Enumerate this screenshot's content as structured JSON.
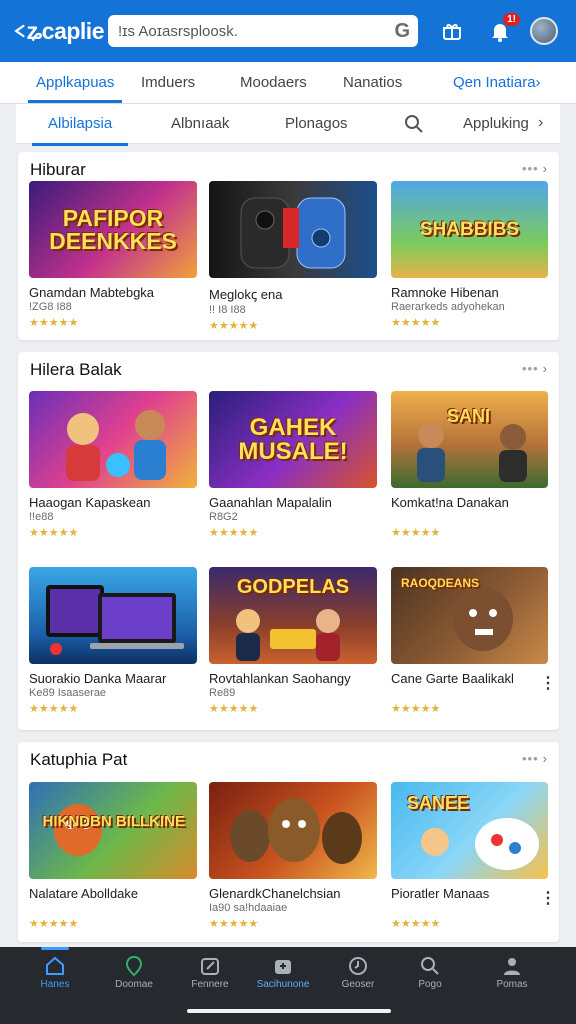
{
  "app": {
    "logo_text": "ʑcaplie",
    "search_placeholder": "!ɪs Aoɪasrsploosk.",
    "search_glyph": "G",
    "notification_count": "1!"
  },
  "primary_tabs": [
    {
      "label": "Applkapuas",
      "active": true
    },
    {
      "label": "Imduers"
    },
    {
      "label": "Moodaers"
    },
    {
      "label": "Nanatios"
    },
    {
      "label": "Qen Inatiara›"
    }
  ],
  "secondary_tabs": [
    {
      "label": "Albilapsia",
      "active": true
    },
    {
      "label": "Albnıaak"
    },
    {
      "label": "Plonagos"
    },
    {
      "label": "Appluking"
    }
  ],
  "sections": [
    {
      "title": "Hiburar",
      "more": "•••",
      "cards": [
        {
          "title": "Gnamdan Mabtebgka",
          "sub": "!ZG8 I88",
          "stars": "★★★★★",
          "art": "PAFIPOR DEENKKES",
          "bg": "linear-gradient(135deg,#3a1c7a,#c2318d 55%,#f0a23b)",
          "text_color": "#ffd54a"
        },
        {
          "title": "Meglokꞔ ena",
          "sub": "!! I8 I88",
          "stars": "★★★★★",
          "art": "",
          "bg": "linear-gradient(90deg,#141414,#3a3a3a 50%,#1d4f8c)",
          "text_color": "#fff"
        },
        {
          "title": "Ramnoke Hibenan",
          "sub": "Raerarkeds adyohekan",
          "stars": "★★★★★",
          "art": "SHABBIBS",
          "bg": "linear-gradient(180deg,#4fa6e6,#7dcb5b 65%,#e8b24a)",
          "text_color": "#ffd54a"
        }
      ]
    },
    {
      "title": "Hilera Balak",
      "more": "•••",
      "cards": [
        {
          "title": "Haaogan Kapaskean",
          "sub": "!!e88",
          "stars": "★★★★★",
          "art": "",
          "bg": "linear-gradient(135deg,#6a2fb8,#e0418f 50%,#f2b13a)",
          "text_color": "#fff"
        },
        {
          "title": "Gaanahlan Mapalalin",
          "sub": "R8G2",
          "stars": "★★★★★",
          "art": "GAHEK MUSALE!",
          "bg": "linear-gradient(135deg,#2a1f7a,#8a2fc4 55%,#d8542a)",
          "text_color": "#ffd54a"
        },
        {
          "title": "Komkat!na Danakan",
          "sub": "",
          "stars": "★★★★★",
          "art": "SANI",
          "bg": "linear-gradient(180deg,#f0b04a,#b4733a 55%,#3c6b2f)",
          "text_color": "#ffe07a"
        },
        {
          "title": "Suorakio Danka Maarar",
          "sub": "Ke89 Isaaserae",
          "stars": "★★★★★",
          "art": "",
          "bg": "linear-gradient(180deg,#39a6e8,#1b5fa8 70%,#0d2f63)",
          "text_color": "#fff"
        },
        {
          "title": "Rovtahlankan Saohangy",
          "sub": "Re89",
          "stars": "★★★★★",
          "art": "GODPELAS",
          "bg": "linear-gradient(180deg,#3a2a6e,#8a3f2a 60%,#c9622f)",
          "text_color": "#ffd54a"
        },
        {
          "title": "Cane Garte Baalikakl",
          "sub": "",
          "stars": "★★★★★",
          "art": "RAOQDEANS",
          "bg": "linear-gradient(135deg,#4a3322,#8b5a33 55%,#c98a4a)",
          "text_color": "#ffcf5a"
        }
      ]
    },
    {
      "title": "Katuphia Pat",
      "more": "•••",
      "cards": [
        {
          "title": "Nalatare Abolldake",
          "sub": "",
          "stars": "★★★★★",
          "art": "HIKNDBN BILLKINE",
          "bg": "linear-gradient(135deg,#2f6fb8,#6cb84a 55%,#d88a2a)",
          "text_color": "#ffd54a"
        },
        {
          "title": "GlenardkChanelchsian",
          "sub": "Ia90 sa!hdaaiae",
          "stars": "★★★★★",
          "art": "",
          "bg": "linear-gradient(135deg,#7a2010,#c9531f 55%,#f0b84a)",
          "text_color": "#fff"
        },
        {
          "title": "Pioratler Manaas",
          "sub": "",
          "stars": "★★★★★",
          "art": "SANEE",
          "bg": "linear-gradient(135deg,#47b9f0,#8ad6f6 55%,#f7c04a)",
          "text_color": "#ffd54a"
        }
      ]
    }
  ],
  "bottom_nav": [
    {
      "label": "Hanes",
      "icon": "home-icon",
      "active": true
    },
    {
      "label": "Doomae",
      "icon": "location-icon"
    },
    {
      "label": "Fennere",
      "icon": "edit-icon"
    },
    {
      "label": "Sacihunone",
      "icon": "store-icon",
      "highlight": true
    },
    {
      "label": "Geoser",
      "icon": "clock-icon"
    },
    {
      "label": "Pogo",
      "icon": "search-icon"
    },
    {
      "label": "Pomas",
      "icon": "profile-icon"
    }
  ]
}
